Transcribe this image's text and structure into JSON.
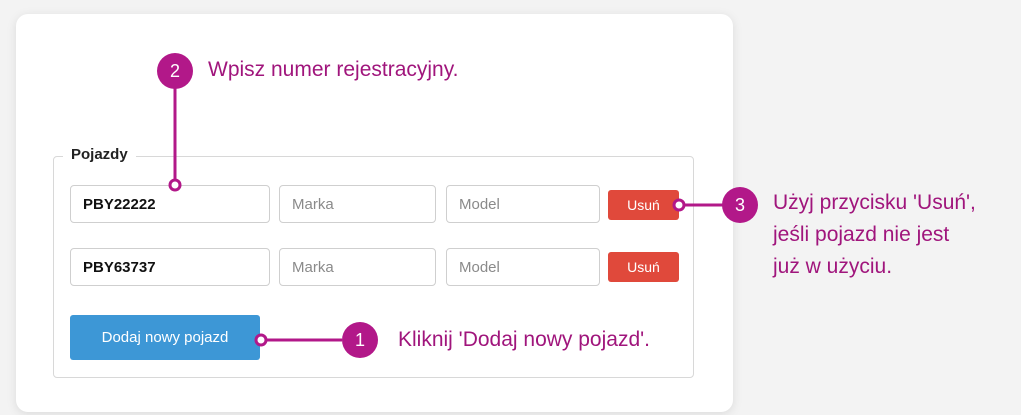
{
  "form": {
    "legend": "Pojazdy",
    "rows": [
      {
        "plate": "PBY22222",
        "brand_placeholder": "Marka",
        "model_placeholder": "Model",
        "remove_label": "Usuń"
      },
      {
        "plate": "PBY63737",
        "brand_placeholder": "Marka",
        "model_placeholder": "Model",
        "remove_label": "Usuń"
      }
    ],
    "add_label": "Dodaj nowy pojazd"
  },
  "callouts": {
    "step1": {
      "number": "1",
      "text": "Kliknij 'Dodaj nowy pojazd'."
    },
    "step2": {
      "number": "2",
      "text": "Wpisz numer rejestracyjny."
    },
    "step3": {
      "number": "3",
      "line1": "Użyj przycisku 'Usuń',",
      "line2": "jeśli pojazd nie jest",
      "line3": "już w użyciu."
    }
  },
  "colors": {
    "accent": "#b21889",
    "remove_button": "#e0493b",
    "add_button": "#3d97d6"
  }
}
